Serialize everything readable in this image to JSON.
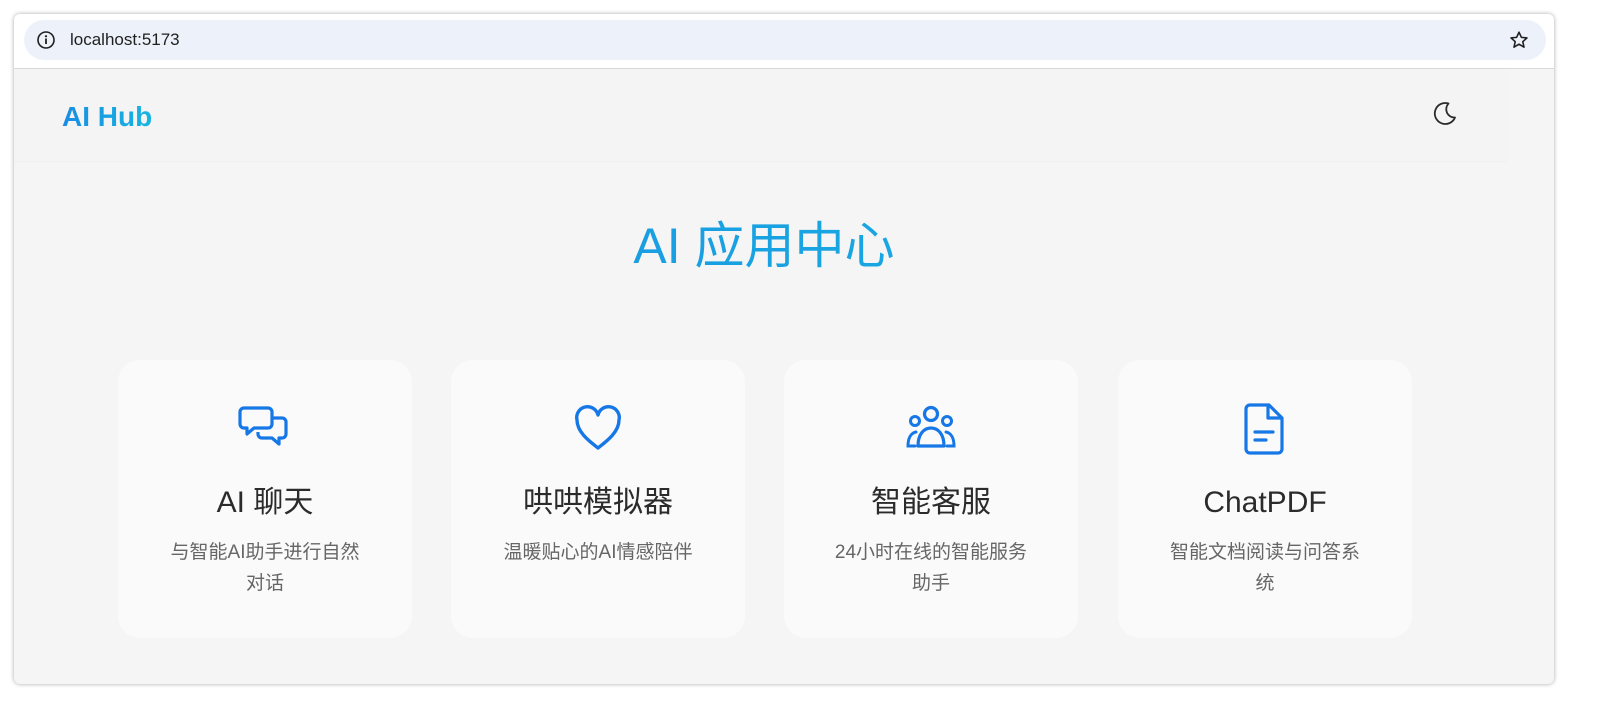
{
  "browser": {
    "url": "localhost:5173"
  },
  "header": {
    "logo": "AI Hub"
  },
  "main": {
    "title": "AI 应用中心",
    "cards": [
      {
        "title": "AI 聊天",
        "description": "与智能AI助手进行自然对话",
        "icon": "chat-bubbles-icon"
      },
      {
        "title": "哄哄模拟器",
        "description": "温暖贴心的AI情感陪伴",
        "icon": "heart-icon"
      },
      {
        "title": "智能客服",
        "description": "24小时在线的智能服务助手",
        "icon": "users-group-icon"
      },
      {
        "title": "ChatPDF",
        "description": "智能文档阅读与问答系统",
        "icon": "document-icon"
      }
    ]
  },
  "colors": {
    "accent": "#1a8ce3",
    "accent_light": "#18b8e2",
    "icon_blue": "#1677e6",
    "background": "#f5f5f5",
    "card": "#fafafa"
  }
}
